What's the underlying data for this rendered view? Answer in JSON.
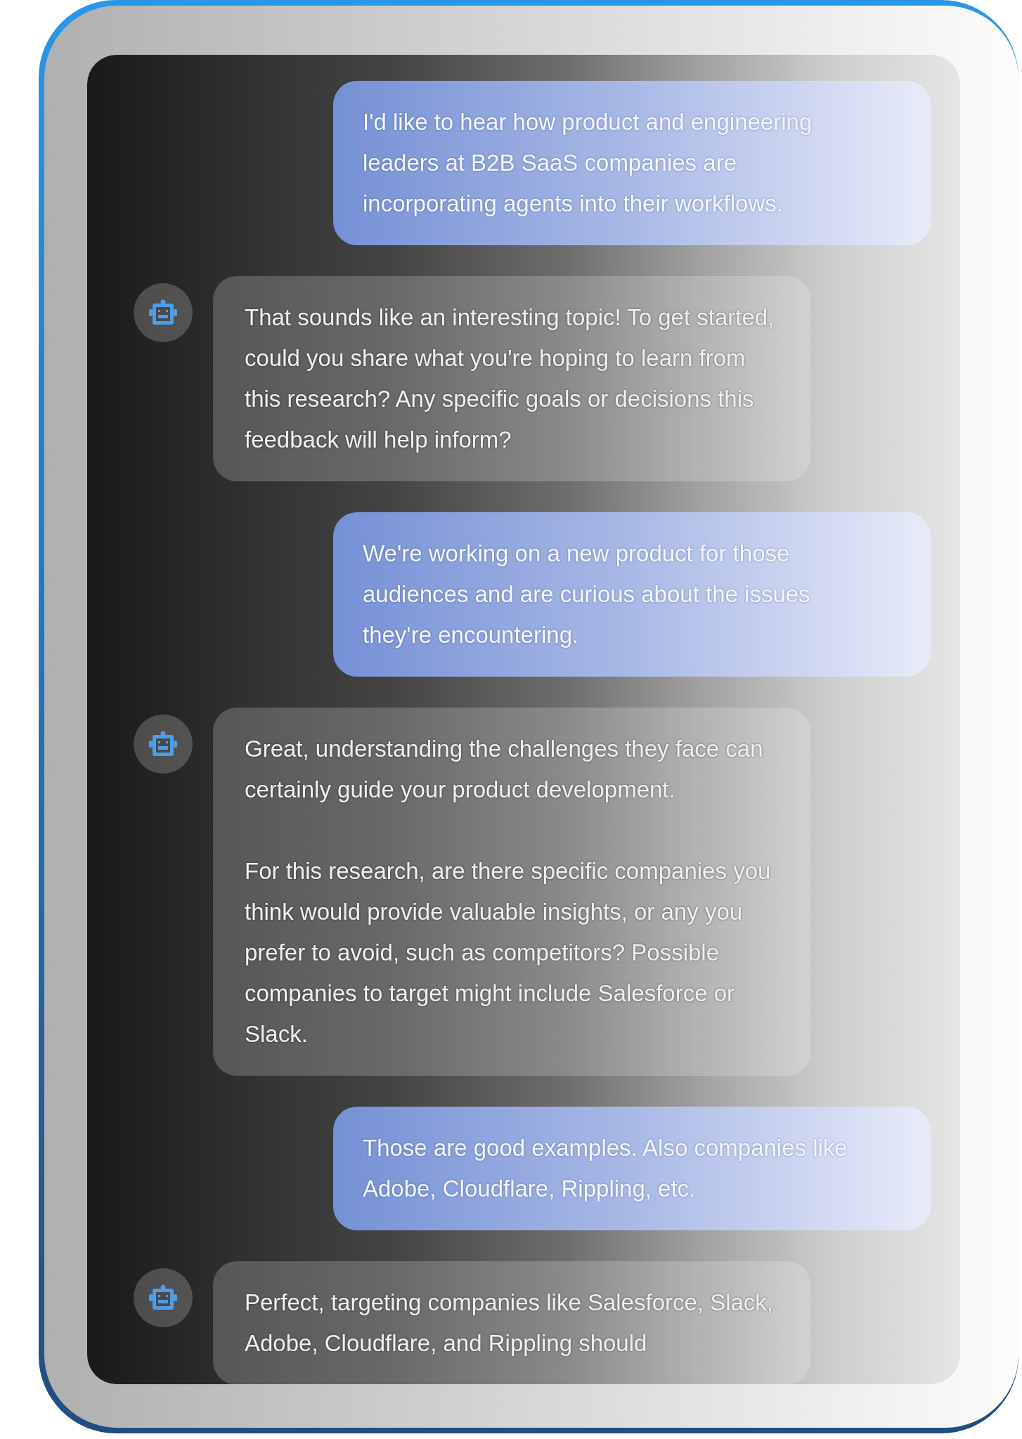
{
  "messages": [
    {
      "kind": "user",
      "paragraphs": [
        "I'd like to hear how product and engineering leaders at B2B SaaS companies are incorporating agents into their workflows."
      ]
    },
    {
      "kind": "assistant",
      "paragraphs": [
        "That sounds like an interesting topic! To get started, could you share what you're hoping to learn from this research? Any specific goals or decisions this feedback will help inform?"
      ]
    },
    {
      "kind": "user",
      "paragraphs": [
        "We're working on a new product for those audiences and are curious about the issues they're encountering."
      ]
    },
    {
      "kind": "assistant",
      "paragraphs": [
        "Great, understanding the challenges they face can certainly guide your product development.",
        "For this research, are there specific companies you think would provide valuable insights, or any you prefer to avoid, such as competitors? Possible companies to target might include Salesforce or Slack."
      ]
    },
    {
      "kind": "user",
      "paragraphs": [
        "Those are good examples. Also companies like Adobe, Cloudflare, Rippling, etc."
      ]
    },
    {
      "kind": "assistant",
      "paragraphs": [
        "Perfect, targeting companies like Salesforce, Slack, Adobe, Cloudflare, and Rippling should"
      ]
    }
  ]
}
